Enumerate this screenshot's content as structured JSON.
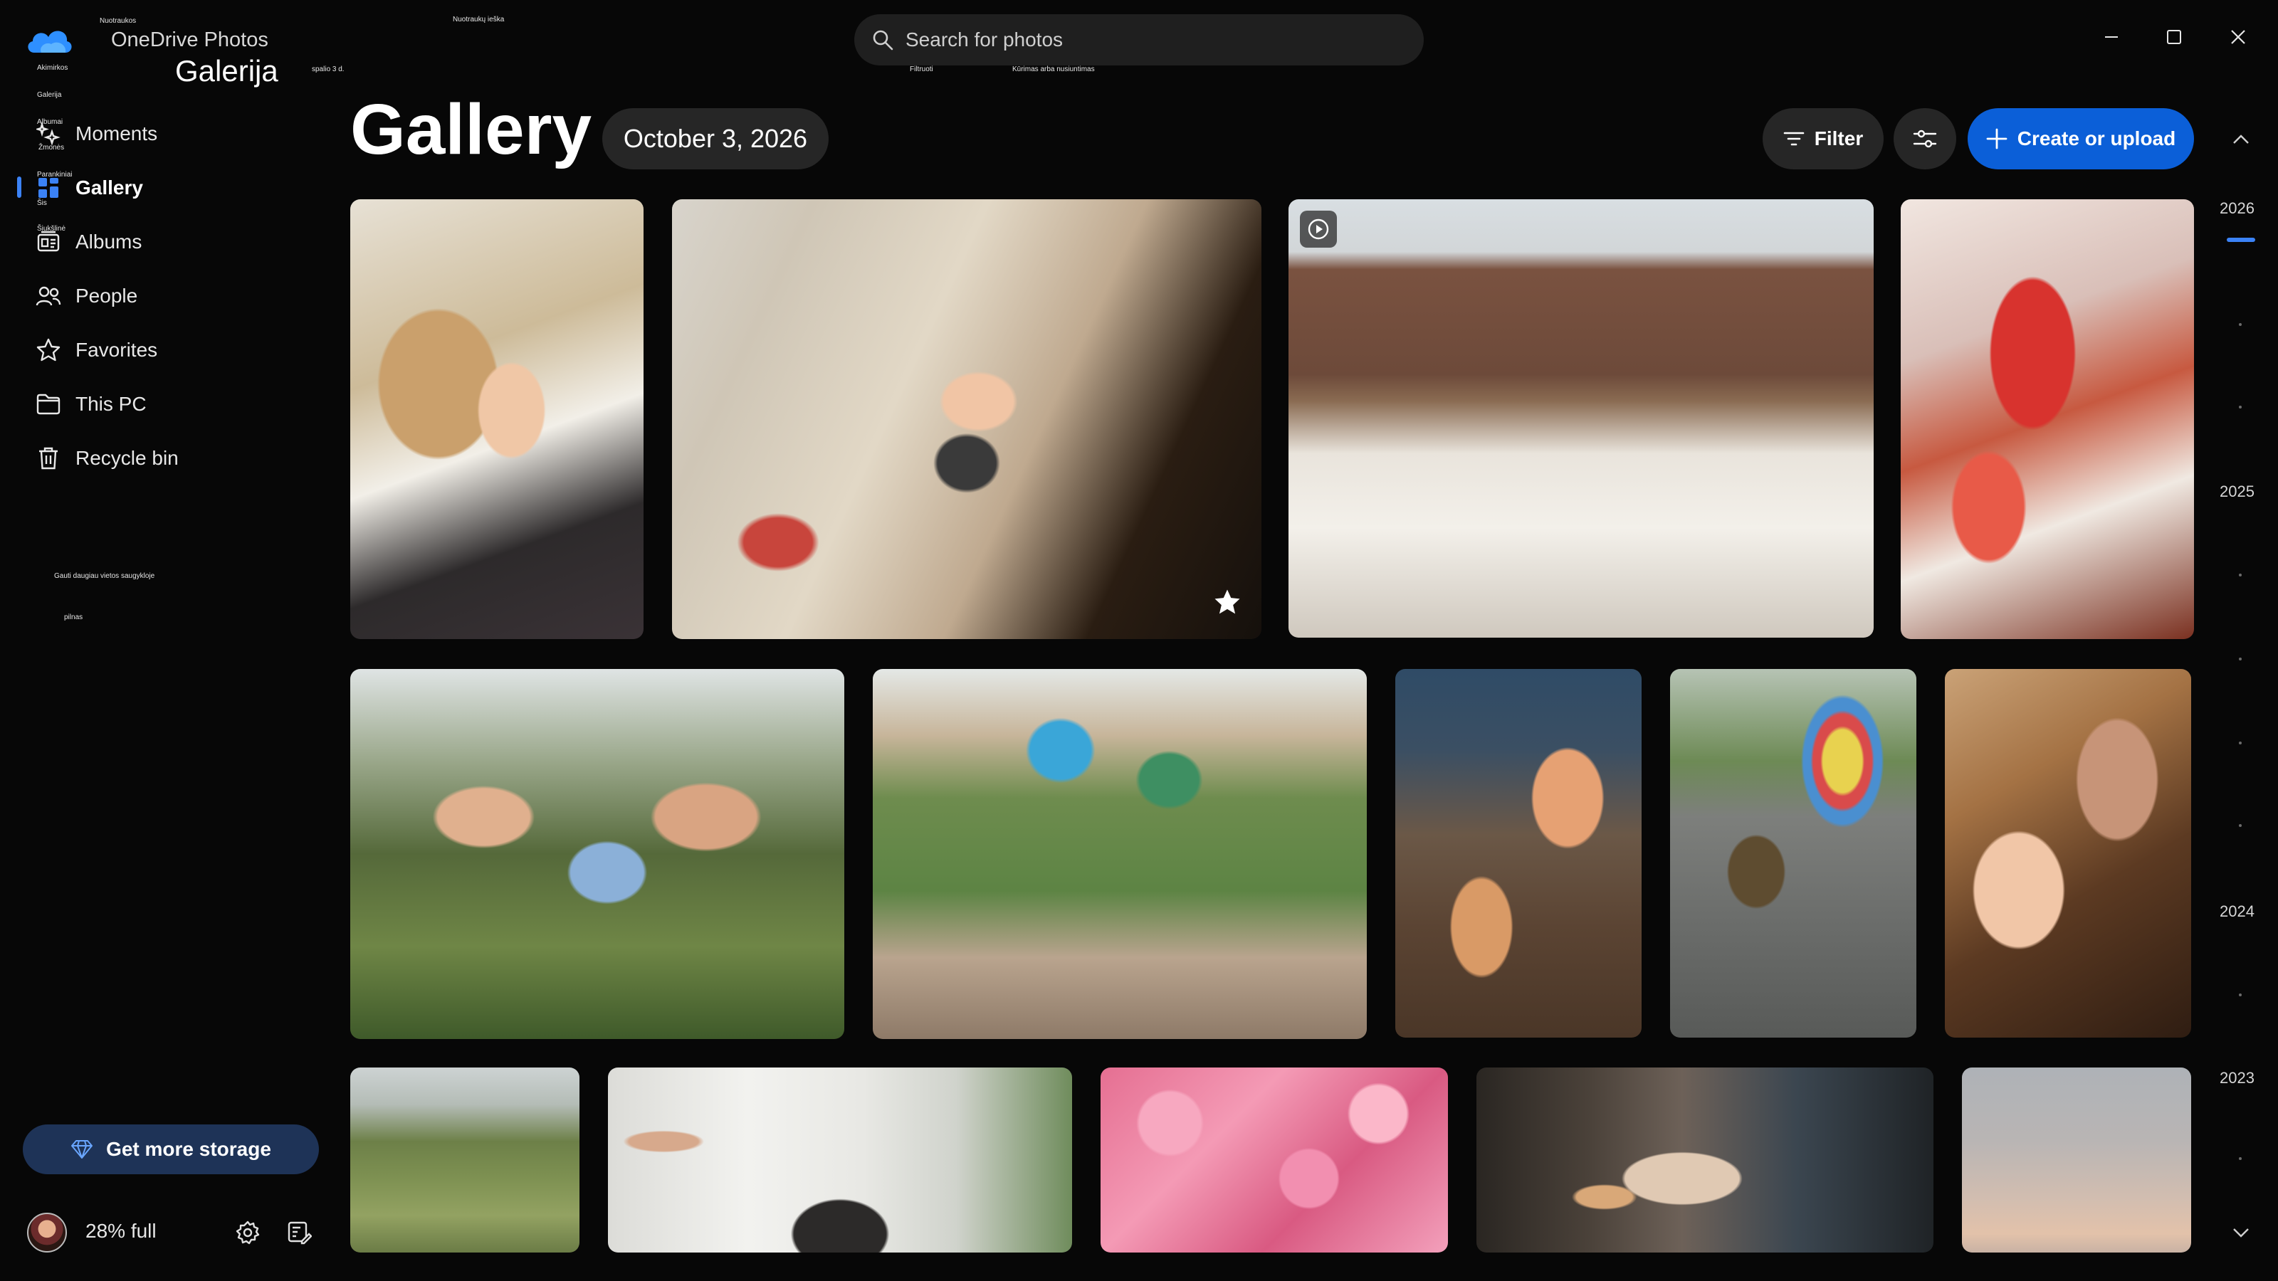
{
  "app": {
    "title": "OneDrive Photos",
    "subtitle": "Galerija"
  },
  "tiny_labels": {
    "nuotraukos": "Nuotraukos",
    "nuotrauku_ieska": "Nuotraukų ieška",
    "akimirkos": "Akimirkos",
    "galerija": "Galerija",
    "albumai": "Albumai",
    "zmones": "Žmonės",
    "parankiniai": "Parankiniai",
    "sis": "Šis",
    "siuksline": "Šiukšlinė",
    "spalio": "spalio 3 d.",
    "filtruoti": "Filtruoti",
    "kurimas": "Kūrimas arba nusiuntimas",
    "gauti": "Gauti daugiau vietos saugykloje",
    "pilnas": "pilnas"
  },
  "sidebar": {
    "items": [
      {
        "label": "Moments",
        "icon": "moments-icon"
      },
      {
        "label": "Gallery",
        "icon": "gallery-icon",
        "active": true
      },
      {
        "label": "Albums",
        "icon": "albums-icon"
      },
      {
        "label": "People",
        "icon": "people-icon"
      },
      {
        "label": "Favorites",
        "icon": "star-icon"
      },
      {
        "label": "This PC",
        "icon": "folder-icon"
      },
      {
        "label": "Recycle bin",
        "icon": "trash-icon"
      }
    ],
    "storage_button": "Get more storage",
    "storage_status": "28% full"
  },
  "search": {
    "placeholder": "Search for photos"
  },
  "header": {
    "title": "Gallery",
    "date": "October 3, 2026",
    "filter_label": "Filter",
    "create_label": "Create or upload"
  },
  "timeline": {
    "years": [
      "2026",
      "2025",
      "2024",
      "2023"
    ]
  },
  "colors": {
    "accent": "#3b82f6",
    "primary_button": "#0b5fd8",
    "background": "#070707",
    "chip": "#262626"
  },
  "photos": [
    {
      "name": "photo-girl-laughing-couch",
      "row": 1
    },
    {
      "name": "photo-child-cardboard-tv",
      "row": 1,
      "favorite": true
    },
    {
      "name": "photo-family-garden-tea-party",
      "row": 1,
      "video": true
    },
    {
      "name": "photo-pouring-red-drink",
      "row": 1
    },
    {
      "name": "photo-girls-field-flowers",
      "row": 2
    },
    {
      "name": "photo-kids-shark-masks",
      "row": 2
    },
    {
      "name": "photo-rain-boots-shovel",
      "row": 2
    },
    {
      "name": "photo-kids-rainbow-umbrella",
      "row": 2
    },
    {
      "name": "photo-mother-child-laughing",
      "row": 2
    },
    {
      "name": "photo-dog-green-hills",
      "row": 3
    },
    {
      "name": "photo-dog-plants-room",
      "row": 3
    },
    {
      "name": "photo-pink-flowers",
      "row": 3
    },
    {
      "name": "photo-person-eating-cafe",
      "row": 3
    },
    {
      "name": "photo-sunset-sky",
      "row": 3
    }
  ]
}
